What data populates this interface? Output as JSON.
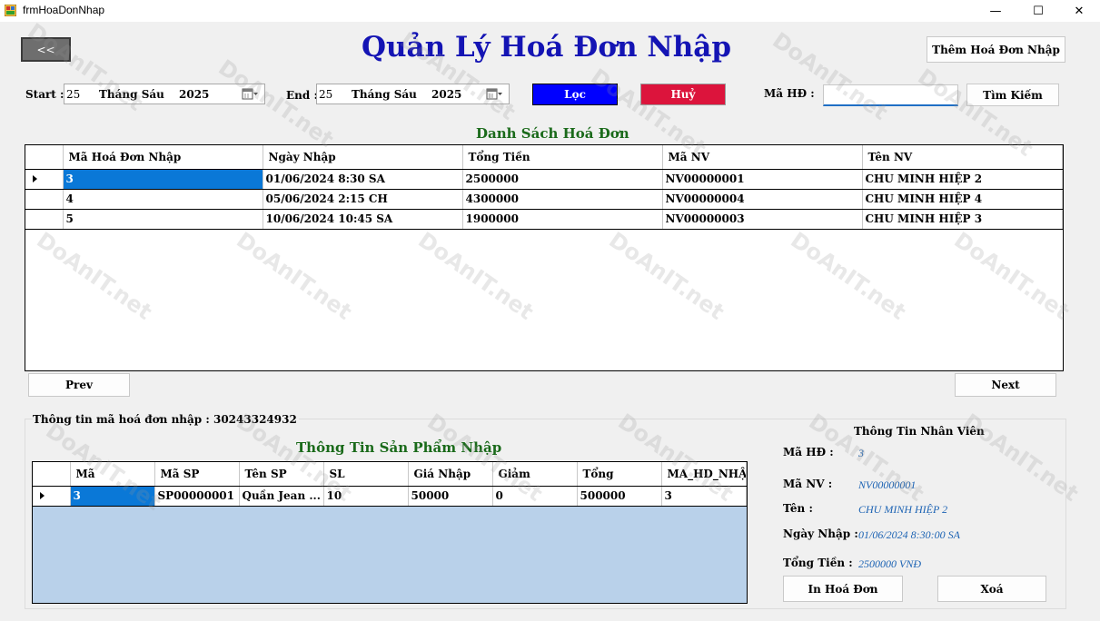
{
  "window": {
    "title": "frmHoaDonNhap",
    "minimize_glyph": "—",
    "maximize_glyph": "☐",
    "close_glyph": "✕"
  },
  "header": {
    "back_label": "<<",
    "title": "Quản Lý Hoá Đơn Nhập",
    "add_label": "Thêm Hoá Đơn Nhập"
  },
  "filter": {
    "start_label": "Start :",
    "start_day": "25",
    "start_month": "Tháng Sáu",
    "start_year": "2025",
    "end_label": "End :",
    "end_day": "25",
    "end_month": "Tháng Sáu",
    "end_year": "2025",
    "filter_label": "Lọc",
    "cancel_label": "Huỷ",
    "search_label": "Mã HĐ :",
    "search_value": "",
    "search_button": "Tìm Kiếm"
  },
  "invoices": {
    "title": "Danh Sách Hoá Đơn",
    "columns": [
      "Mã Hoá Đơn Nhập",
      "Ngày Nhập",
      "Tổng Tiền",
      "Mã NV",
      "Tên NV"
    ],
    "rows": [
      [
        "3",
        "01/06/2024 8:30 SA",
        "2500000",
        "NV00000001",
        "CHU MINH HIỆP 2"
      ],
      [
        "4",
        "05/06/2024 2:15 CH",
        "4300000",
        "NV00000004",
        "CHU MINH HIỆP 4"
      ],
      [
        "5",
        "10/06/2024 10:45 SA",
        "1900000",
        "NV00000003",
        "CHU MINH HIỆP 3"
      ]
    ],
    "prev_label": "Prev",
    "next_label": "Next"
  },
  "detail": {
    "info_line": "Thông tin mã  hoá đơn  nhập : 30243324932",
    "products_title": "Thông Tin Sản Phẩm Nhập",
    "columns": [
      "Mã",
      "Mã SP",
      "Tên SP",
      "SL",
      "Giá Nhập",
      "Giảm",
      "Tổng",
      "MA_HD_NHẬ"
    ],
    "rows": [
      [
        "3",
        "SP00000001",
        "Quần Jean ...",
        "10",
        "50000",
        "0",
        "500000",
        "3"
      ]
    ]
  },
  "employee": {
    "title": "Thông Tin Nhân Viên",
    "invoice_label": "Mã HĐ :",
    "invoice_value": "3",
    "id_label": "Mã NV :",
    "id_value": "NV00000001",
    "name_label": "Tên  :",
    "name_value": "CHU MINH HIỆP 2",
    "date_label": "Ngày Nhập :",
    "date_value": "01/06/2024 8:30:00 SA",
    "total_label": "Tổng Tiền :",
    "total_value": "2500000 VNĐ",
    "print_label": "In Hoá Đơn",
    "delete_label": "Xoá"
  },
  "watermark": {
    "text": "DoAnIT.net"
  },
  "colors": {
    "title": "#1414b4",
    "filter": "#0000ff",
    "cancel": "#dc143c",
    "section": "#1a6a1a",
    "selection": "#0a78d7",
    "empty_grid": "#b9d1ea",
    "info_value": "#1e64b4"
  }
}
